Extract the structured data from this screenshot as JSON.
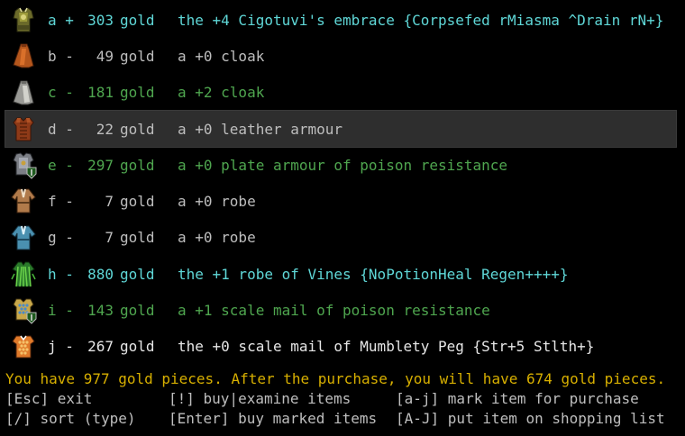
{
  "items": [
    {
      "letter": "a",
      "mark": "+",
      "price": "303",
      "currency": "gold",
      "description": "the +4 Cigotuvi's embrace {Corpsefed rMiasma ^Drain rN+}",
      "color_class": "c-artefact",
      "icon": "cigotuvi-embrace-icon",
      "highlighted": false
    },
    {
      "letter": "b",
      "mark": "-",
      "price": "49",
      "currency": "gold",
      "description": "a +0 cloak",
      "color_class": "c-normal",
      "icon": "brown-cloak-icon",
      "highlighted": false
    },
    {
      "letter": "c",
      "mark": "-",
      "price": "181",
      "currency": "gold",
      "description": "a +2 cloak",
      "color_class": "c-ego",
      "icon": "grey-cloak-icon",
      "highlighted": false
    },
    {
      "letter": "d",
      "mark": "-",
      "price": "22",
      "currency": "gold",
      "description": "a +0 leather armour",
      "color_class": "c-normal",
      "icon": "leather-armour-icon",
      "highlighted": true
    },
    {
      "letter": "e",
      "mark": "-",
      "price": "297",
      "currency": "gold",
      "description": "a +0 plate armour of poison resistance",
      "color_class": "c-ego",
      "icon": "plate-armour-icon",
      "highlighted": false
    },
    {
      "letter": "f",
      "mark": "-",
      "price": "7",
      "currency": "gold",
      "description": "a +0 robe",
      "color_class": "c-normal",
      "icon": "brown-robe-icon",
      "highlighted": false
    },
    {
      "letter": "g",
      "mark": "-",
      "price": "7",
      "currency": "gold",
      "description": "a +0 robe",
      "color_class": "c-normal",
      "icon": "blue-robe-icon",
      "highlighted": false
    },
    {
      "letter": "h",
      "mark": "-",
      "price": "880",
      "currency": "gold",
      "description": "the +1 robe of Vines {NoPotionHeal Regen++++}",
      "color_class": "c-artefact",
      "icon": "robe-of-vines-icon",
      "highlighted": false
    },
    {
      "letter": "i",
      "mark": "-",
      "price": "143",
      "currency": "gold",
      "description": "a +1 scale mail of poison resistance",
      "color_class": "c-ego",
      "icon": "scale-mail-blue-icon",
      "highlighted": false
    },
    {
      "letter": "j",
      "mark": "-",
      "price": "267",
      "currency": "gold",
      "description": "the +0 scale mail of Mumblety Peg {Str+5 Stlth+}",
      "color_class": "c-randart",
      "icon": "scale-mail-orange-icon",
      "highlighted": false
    }
  ],
  "status_line": "You have 977 gold pieces. After the purchase, you will have 674 gold pieces.",
  "commands": [
    [
      "[Esc] exit",
      "[!] buy|examine items",
      "[a-j] mark item for purchase"
    ],
    [
      "[/] sort (type)",
      "[Enter] buy marked items",
      "[A-J] put item on shopping list"
    ]
  ],
  "colors": {
    "background": "#000000",
    "normal": "#bebebe",
    "artefact": "#5fd7d7",
    "ego": "#4fa64f",
    "status": "#d7af00",
    "highlight": "#2e2e2e"
  }
}
